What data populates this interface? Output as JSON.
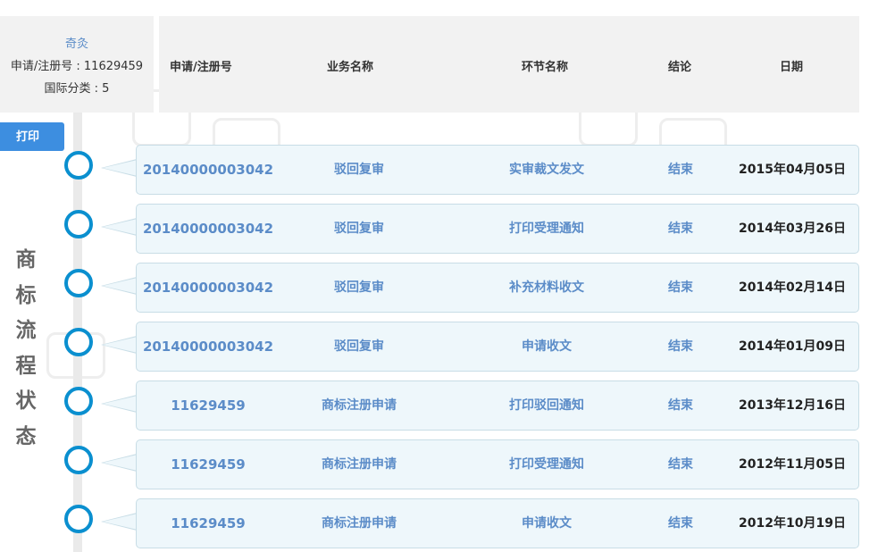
{
  "info": {
    "applicant": "奇灸",
    "reg_line": "申请/注册号 : 11629459",
    "class_line": "国际分类 : 5"
  },
  "header": {
    "col_no": "申请/注册号",
    "col_biz": "业务名称",
    "col_step": "环节名称",
    "col_result": "结论",
    "col_date": "日期"
  },
  "print_label": "打印",
  "side_title": [
    "商",
    "标",
    "流",
    "程",
    "状",
    "态"
  ],
  "colors": {
    "accent": "#3d8ee0",
    "node": "#0a8fcf",
    "link_text": "#5b8cc8",
    "card_bg": "#eef7fb"
  },
  "rows": [
    {
      "no": "20140000003042",
      "biz": "驳回复审",
      "step": "实审裁文发文",
      "result": "结束",
      "date": "2015年04月05日"
    },
    {
      "no": "20140000003042",
      "biz": "驳回复审",
      "step": "打印受理通知",
      "result": "结束",
      "date": "2014年03月26日"
    },
    {
      "no": "20140000003042",
      "biz": "驳回复审",
      "step": "补充材料收文",
      "result": "结束",
      "date": "2014年02月14日"
    },
    {
      "no": "20140000003042",
      "biz": "驳回复审",
      "step": "申请收文",
      "result": "结束",
      "date": "2014年01月09日"
    },
    {
      "no": "11629459",
      "biz": "商标注册申请",
      "step": "打印驳回通知",
      "result": "结束",
      "date": "2013年12月16日"
    },
    {
      "no": "11629459",
      "biz": "商标注册申请",
      "step": "打印受理通知",
      "result": "结束",
      "date": "2012年11月05日"
    },
    {
      "no": "11629459",
      "biz": "商标注册申请",
      "step": "申请收文",
      "result": "结束",
      "date": "2012年10月19日"
    }
  ]
}
